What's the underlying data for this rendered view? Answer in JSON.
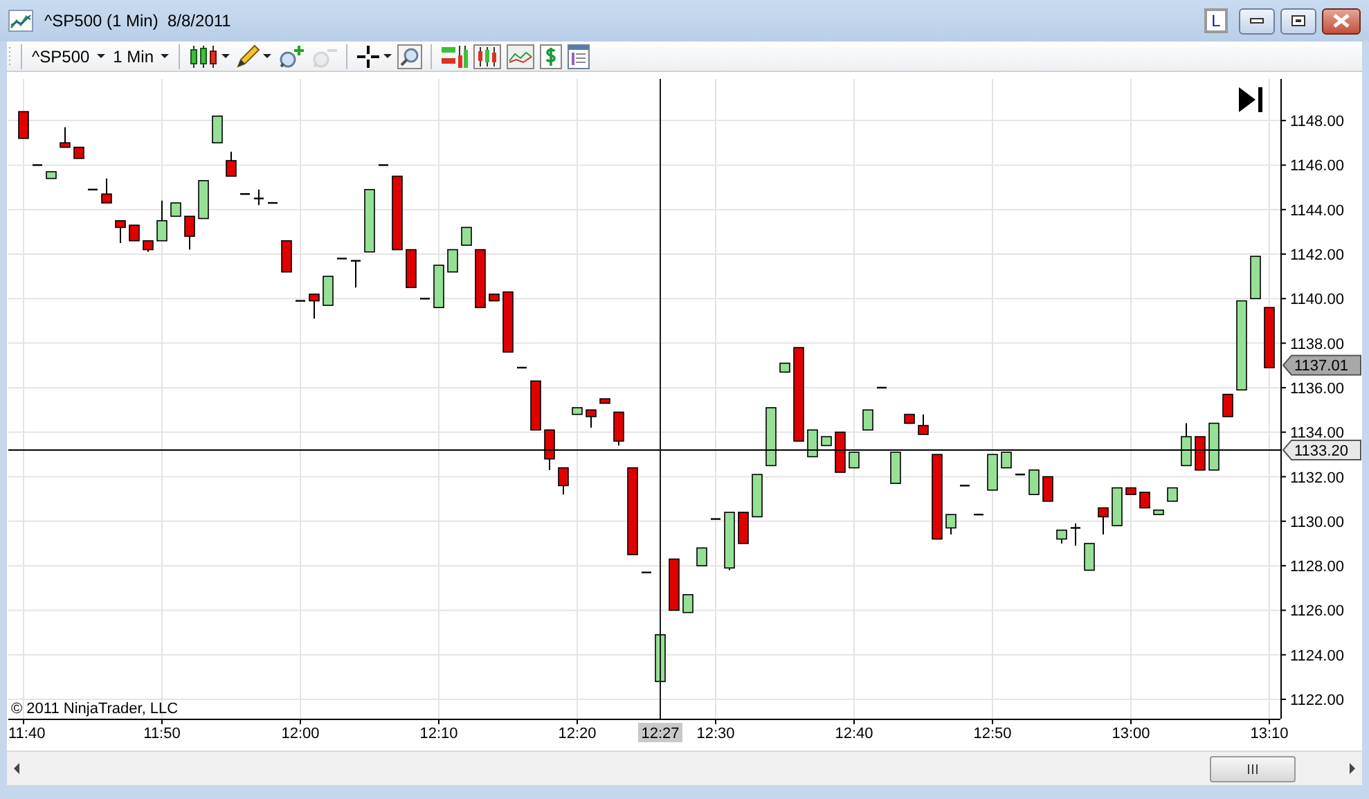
{
  "window": {
    "title": "^SP500 (1 Min)  8/8/2011",
    "layout_button": "L"
  },
  "toolbar": {
    "instrument": "^SP500",
    "interval": "1 Min",
    "zoom_out_disabled": true
  },
  "chart": {
    "copyright": "© 2011 NinjaTrader, LLC",
    "last_price_tag": "1137.01",
    "crosshair_time_tag": "12:27",
    "chart_data": {
      "type": "candlestick",
      "grid": true,
      "ref_lines": [
        {
          "axis": "y",
          "value": 1133.2,
          "label": "1133.20"
        }
      ],
      "categories": [
        "11:40",
        null,
        null,
        null,
        null,
        null,
        null,
        null,
        null,
        null,
        "11:50",
        null,
        null,
        null,
        null,
        null,
        null,
        null,
        null,
        null,
        "12:00",
        null,
        null,
        null,
        null,
        null,
        null,
        null,
        null,
        null,
        "12:10",
        null,
        null,
        null,
        null,
        null,
        null,
        null,
        null,
        null,
        "12:20",
        null,
        null,
        null,
        null,
        null,
        null,
        null,
        null,
        null,
        "12:30",
        null,
        null,
        null,
        null,
        null,
        null,
        null,
        null,
        null,
        "12:40",
        null,
        null,
        null,
        null,
        null,
        null,
        null,
        null,
        null,
        "12:50",
        null,
        null,
        null,
        null,
        null,
        null,
        null,
        null,
        null,
        "13:00",
        null,
        null,
        null,
        null,
        null,
        null,
        null,
        null,
        null,
        "13:10"
      ],
      "ohlc": [
        [
          1148.4,
          1148.4,
          1147.2,
          1147.2
        ],
        [
          1146.0,
          1146.0,
          1146.0,
          1146.0
        ],
        [
          1145.4,
          1145.7,
          1145.4,
          1145.7
        ],
        [
          1147.0,
          1147.7,
          1146.8,
          1146.8
        ],
        [
          1146.8,
          1146.8,
          1146.3,
          1146.3
        ],
        [
          1144.9,
          1144.9,
          1144.9,
          1144.9
        ],
        [
          1144.7,
          1145.4,
          1144.3,
          1144.3
        ],
        [
          1143.5,
          1143.5,
          1142.5,
          1143.2
        ],
        [
          1143.3,
          1143.3,
          1142.6,
          1142.6
        ],
        [
          1142.6,
          1142.6,
          1142.1,
          1142.2
        ],
        [
          1142.6,
          1144.4,
          1142.6,
          1143.5
        ],
        [
          1143.7,
          1144.3,
          1143.7,
          1144.3
        ],
        [
          1143.7,
          1143.7,
          1142.2,
          1142.8
        ],
        [
          1143.6,
          1145.3,
          1143.6,
          1145.3
        ],
        [
          1147.0,
          1148.2,
          1147.0,
          1148.2
        ],
        [
          1146.2,
          1146.6,
          1145.5,
          1145.5
        ],
        [
          1144.7,
          1144.7,
          1144.7,
          1144.7
        ],
        [
          1144.5,
          1144.9,
          1144.2,
          1144.5
        ],
        [
          1144.3,
          1144.3,
          1144.3,
          1144.3
        ],
        [
          1142.6,
          1142.6,
          1141.2,
          1141.2
        ],
        [
          1139.9,
          1139.9,
          1139.9,
          1139.9
        ],
        [
          1140.2,
          1140.2,
          1139.1,
          1139.9
        ],
        [
          1139.7,
          1141.0,
          1139.7,
          1141.0
        ],
        [
          1141.8,
          1141.8,
          1141.8,
          1141.8
        ],
        [
          1141.7,
          1141.7,
          1140.5,
          1141.7
        ],
        [
          1142.1,
          1144.9,
          1142.1,
          1144.9
        ],
        [
          1146.0,
          1146.0,
          1146.0,
          1146.0
        ],
        [
          1145.5,
          1145.5,
          1142.2,
          1142.2
        ],
        [
          1142.2,
          1142.2,
          1140.5,
          1140.5
        ],
        [
          1140.0,
          1140.0,
          1140.0,
          1140.0
        ],
        [
          1139.6,
          1141.5,
          1139.6,
          1141.5
        ],
        [
          1141.2,
          1142.2,
          1141.2,
          1142.2
        ],
        [
          1142.4,
          1143.2,
          1142.4,
          1143.2
        ],
        [
          1142.2,
          1142.2,
          1139.6,
          1139.6
        ],
        [
          1140.2,
          1140.2,
          1139.9,
          1139.9
        ],
        [
          1140.3,
          1140.3,
          1137.6,
          1137.6
        ],
        [
          1136.9,
          1136.9,
          1136.9,
          1136.9
        ],
        [
          1136.3,
          1136.3,
          1134.1,
          1134.1
        ],
        [
          1134.1,
          1134.1,
          1132.3,
          1132.8
        ],
        [
          1132.4,
          1132.4,
          1131.2,
          1131.6
        ],
        [
          1134.8,
          1135.1,
          1134.8,
          1135.1
        ],
        [
          1135.0,
          1135.0,
          1134.2,
          1134.7
        ],
        [
          1135.5,
          1135.5,
          1135.3,
          1135.3
        ],
        [
          1134.9,
          1134.9,
          1133.4,
          1133.6
        ],
        [
          1132.4,
          1132.4,
          1128.5,
          1128.5
        ],
        [
          1127.7,
          1127.7,
          1127.7,
          1127.7
        ],
        [
          1122.8,
          1124.9,
          1122.7,
          1124.9
        ],
        [
          1128.3,
          1128.3,
          1126.0,
          1126.0
        ],
        [
          1125.9,
          1126.7,
          1125.9,
          1126.7
        ],
        [
          1128.0,
          1128.8,
          1128.0,
          1128.8
        ],
        [
          1130.1,
          1130.1,
          1130.1,
          1130.1
        ],
        [
          1127.9,
          1130.4,
          1127.8,
          1130.4
        ],
        [
          1130.4,
          1130.4,
          1129.0,
          1129.0
        ],
        [
          1130.2,
          1132.1,
          1130.2,
          1132.1
        ],
        [
          1132.5,
          1135.1,
          1132.5,
          1135.1
        ],
        [
          1136.7,
          1137.1,
          1136.7,
          1137.1
        ],
        [
          1137.8,
          1137.8,
          1133.6,
          1133.6
        ],
        [
          1132.9,
          1134.1,
          1132.9,
          1134.1
        ],
        [
          1133.4,
          1133.8,
          1133.4,
          1133.8
        ],
        [
          1134.0,
          1134.0,
          1132.2,
          1132.2
        ],
        [
          1132.4,
          1133.1,
          1132.4,
          1133.1
        ],
        [
          1134.1,
          1135.0,
          1134.1,
          1135.0
        ],
        [
          1136.0,
          1136.0,
          1136.0,
          1136.0
        ],
        [
          1131.7,
          1133.1,
          1131.7,
          1133.1
        ],
        [
          1134.8,
          1134.8,
          1134.4,
          1134.4
        ],
        [
          1134.3,
          1134.8,
          1133.9,
          1133.9
        ],
        [
          1133.0,
          1133.0,
          1129.2,
          1129.2
        ],
        [
          1129.7,
          1130.3,
          1129.4,
          1130.3
        ],
        [
          1131.6,
          1131.6,
          1131.6,
          1131.6
        ],
        [
          1130.3,
          1130.3,
          1130.3,
          1130.3
        ],
        [
          1131.4,
          1133.0,
          1131.4,
          1133.0
        ],
        [
          1132.4,
          1133.1,
          1132.4,
          1133.1
        ],
        [
          1132.1,
          1132.1,
          1132.1,
          1132.1
        ],
        [
          1131.2,
          1132.3,
          1131.2,
          1132.3
        ],
        [
          1132.0,
          1132.0,
          1130.9,
          1130.9
        ],
        [
          1129.2,
          1129.6,
          1129.0,
          1129.6
        ],
        [
          1129.7,
          1129.9,
          1128.9,
          1129.7
        ],
        [
          1127.8,
          1129.0,
          1127.8,
          1129.0
        ],
        [
          1130.6,
          1130.6,
          1129.4,
          1130.2
        ],
        [
          1129.8,
          1131.5,
          1129.8,
          1131.5
        ],
        [
          1131.5,
          1131.5,
          1131.2,
          1131.2
        ],
        [
          1131.3,
          1131.3,
          1130.6,
          1130.6
        ],
        [
          1130.3,
          1130.5,
          1130.3,
          1130.5
        ],
        [
          1130.9,
          1131.5,
          1130.9,
          1131.5
        ],
        [
          1132.5,
          1134.4,
          1132.5,
          1133.8
        ],
        [
          1133.8,
          1133.8,
          1132.3,
          1132.3
        ],
        [
          1132.3,
          1134.4,
          1132.3,
          1134.4
        ],
        [
          1135.7,
          1135.7,
          1134.7,
          1134.7
        ],
        [
          1135.9,
          1139.9,
          1135.9,
          1139.9
        ],
        [
          1140.0,
          1141.9,
          1140.0,
          1141.9
        ],
        [
          1139.6,
          1139.6,
          1136.9,
          1136.9
        ]
      ],
      "ylim": [
        1121.13,
        1149.87
      ],
      "yticks": [
        {
          "value": 1148,
          "label": "1148.00"
        },
        {
          "value": 1146,
          "label": "1146.00"
        },
        {
          "value": 1144,
          "label": "1144.00"
        },
        {
          "value": 1142,
          "label": "1142.00"
        },
        {
          "value": 1140,
          "label": "1140.00"
        },
        {
          "value": 1138,
          "label": "1138.00"
        },
        {
          "value": 1136,
          "label": "1136.00"
        },
        {
          "value": 1134,
          "label": "1134.00"
        },
        {
          "value": 1132,
          "label": "1132.00"
        },
        {
          "value": 1130,
          "label": "1130.00"
        },
        {
          "value": 1128,
          "label": "1128.00"
        },
        {
          "value": 1126,
          "label": "1126.00"
        },
        {
          "value": 1124,
          "label": "1124.00"
        },
        {
          "value": 1122,
          "label": "1122.00"
        }
      ]
    }
  }
}
